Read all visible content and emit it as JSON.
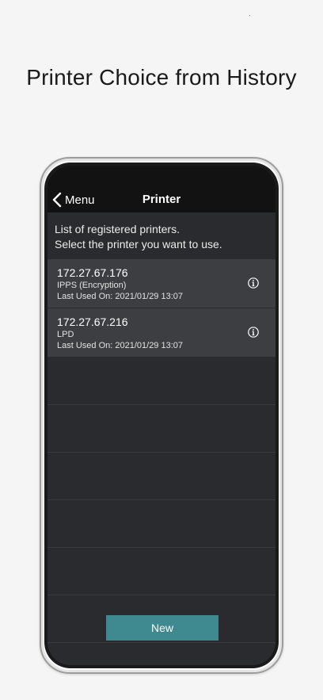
{
  "headline": "Printer Choice from History",
  "navbar": {
    "back_label": "Menu",
    "title": "Printer"
  },
  "intro": {
    "line1": "List of registered printers.",
    "line2": "Select the printer you want to use."
  },
  "printers": [
    {
      "ip": "172.27.67.176",
      "protocol": "IPPS (Encryption)",
      "last_used": "Last Used On: 2021/01/29 13:07",
      "icon": "info-icon"
    },
    {
      "ip": "172.27.67.216",
      "protocol": "LPD",
      "last_used": "Last Used On: 2021/01/29 13:07",
      "icon": "info-icon"
    }
  ],
  "new_button": {
    "label": "New"
  },
  "colors": {
    "accent": "#3f8a91",
    "navbar": "#121212",
    "screen_bg": "#2a2b2e",
    "row_bg": "#3c3e42"
  }
}
